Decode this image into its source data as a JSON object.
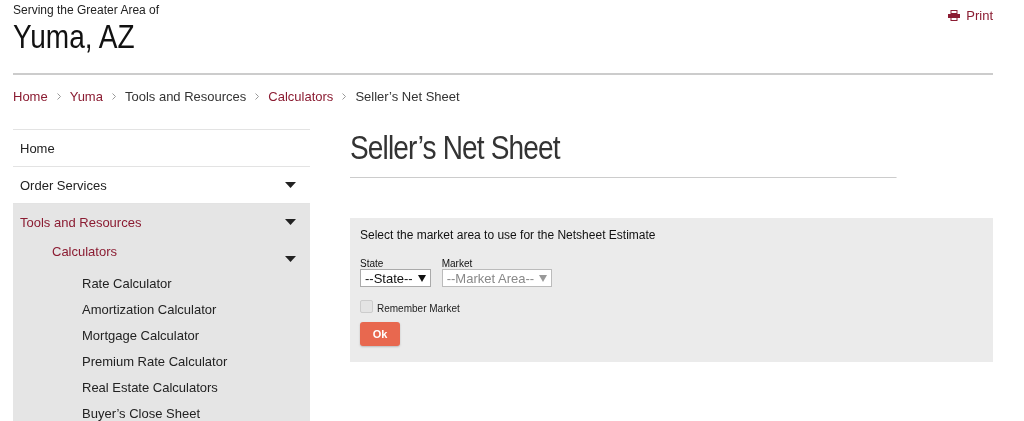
{
  "header": {
    "tagline": "Serving the Greater Area of",
    "city": "Yuma, AZ",
    "print": "Print"
  },
  "breadcrumb": [
    {
      "label": "Home",
      "link": true
    },
    {
      "label": "Yuma",
      "link": true
    },
    {
      "label": "Tools and Resources",
      "link": false
    },
    {
      "label": "Calculators",
      "link": true
    },
    {
      "label": "Seller’s Net Sheet",
      "link": false
    }
  ],
  "sidebar": {
    "items": [
      {
        "label": "Home",
        "current": false
      },
      {
        "label": "Order Services",
        "current": false,
        "expanded": false
      },
      {
        "label": "Tools and Resources",
        "current": true,
        "expanded": true,
        "children": [
          {
            "label": "Calculators",
            "current": true,
            "expanded": true,
            "children": [
              {
                "label": "Rate Calculator",
                "current": false
              },
              {
                "label": "Amortization Calculator",
                "current": false
              },
              {
                "label": "Mortgage Calculator",
                "current": false
              },
              {
                "label": "Premium Rate Calculator",
                "current": false
              },
              {
                "label": "Real Estate Calculators",
                "current": false
              },
              {
                "label": "Buyer’s Close Sheet",
                "current": false
              }
            ]
          }
        ]
      }
    ]
  },
  "page_title": "Seller’s Net Sheet",
  "form": {
    "instruction": "Select the market area to use for the Netsheet Estimate",
    "selects": [
      {
        "label": "State",
        "value": "--State--",
        "disabled": false
      },
      {
        "label": "Market",
        "value": "--Market Area--",
        "disabled": true
      }
    ],
    "remember": {
      "label": "Remember Market",
      "checked": false
    },
    "button": "Ok"
  }
}
